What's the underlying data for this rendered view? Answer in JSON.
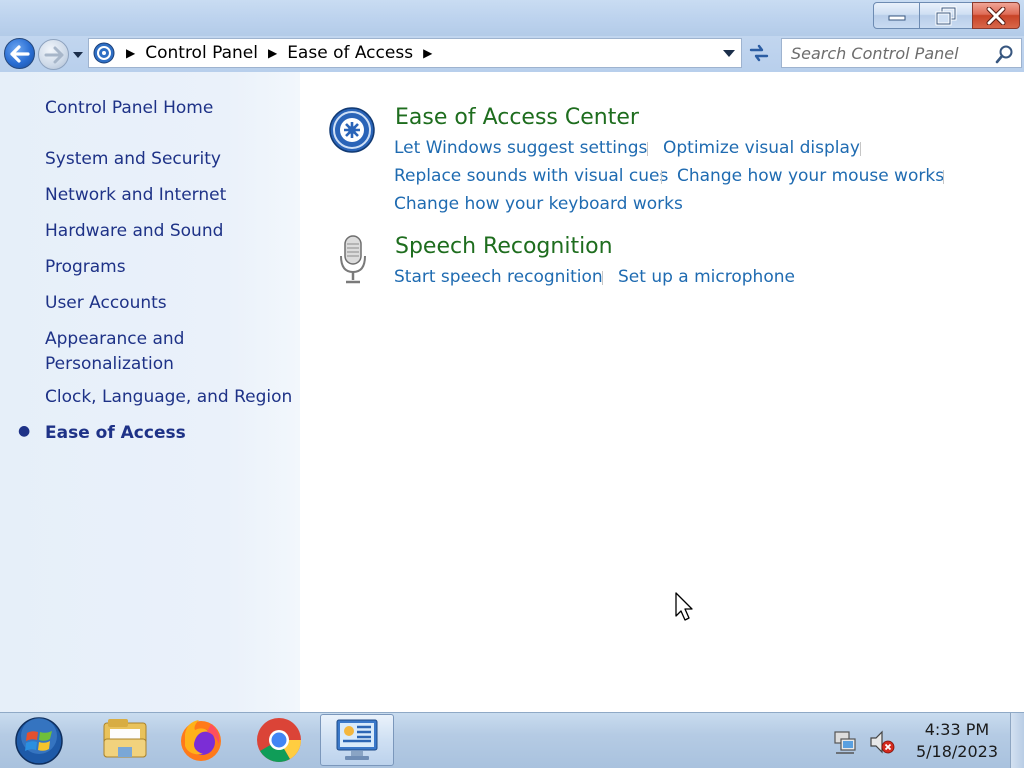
{
  "breadcrumb": [
    "Control Panel",
    "Ease of Access"
  ],
  "search": {
    "placeholder": "Search Control Panel"
  },
  "sidebar": {
    "home": "Control Panel Home",
    "items": [
      {
        "label": "System and Security"
      },
      {
        "label": "Network and Internet"
      },
      {
        "label": "Hardware and Sound"
      },
      {
        "label": "Programs"
      },
      {
        "label": "User Accounts"
      },
      {
        "label": "Appearance and"
      },
      {
        "label": "Personalization"
      },
      {
        "label": "Clock, Language, and Region"
      },
      {
        "label": "Ease of Access"
      }
    ]
  },
  "categories": [
    {
      "title": "Ease of Access Center",
      "icon": "ease-of-access-icon",
      "links": [
        "Let Windows suggest settings",
        "Optimize visual display",
        "Replace sounds with visual cues",
        "Change how your mouse works",
        "Change how your keyboard works"
      ]
    },
    {
      "title": "Speech Recognition",
      "icon": "microphone-icon",
      "links": [
        "Start speech recognition",
        "Set up a microphone"
      ]
    }
  ],
  "taskbar": {
    "apps": [
      "file-explorer-icon",
      "firefox-icon",
      "chrome-icon",
      "control-panel-icon"
    ],
    "active_app": "control-panel-icon",
    "time": "4:33 PM",
    "date": "5/18/2023"
  },
  "colors": {
    "link": "#1f6bb1",
    "category_title": "#1e6d1e",
    "sidebar_text": "#1e3287"
  }
}
